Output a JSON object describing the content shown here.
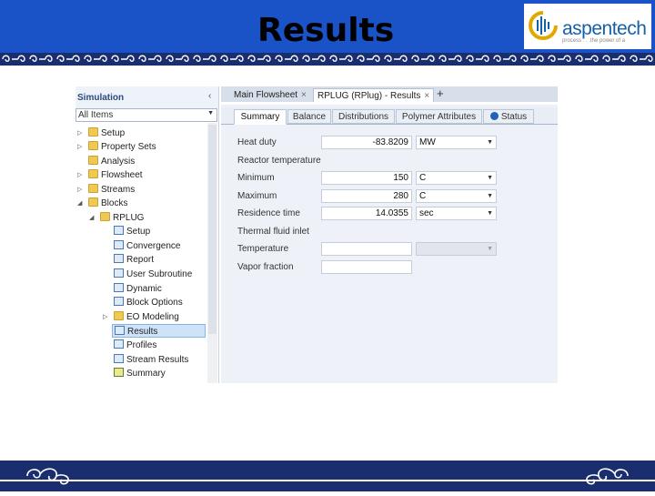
{
  "slide": {
    "title": "Results",
    "logo_text": "aspentech",
    "logo_tagline": "process . . .the power of a",
    "colors": {
      "header_blue": "#1a52c8",
      "pattern_navy": "#1a2d6e",
      "logo_blue": "#1560a8"
    }
  },
  "nav": {
    "title": "Simulation",
    "filter_value": "All Items",
    "items": [
      {
        "label": "Setup",
        "icon": "folder-icon"
      },
      {
        "label": "Property Sets",
        "icon": "folder-icon"
      },
      {
        "label": "Analysis",
        "icon": "folder-icon"
      },
      {
        "label": "Flowsheet",
        "icon": "folder-icon"
      },
      {
        "label": "Streams",
        "icon": "folder-icon"
      },
      {
        "label": "Blocks",
        "icon": "folder-icon"
      },
      {
        "label": "RPLUG",
        "icon": "folder-icon"
      },
      {
        "label": "Setup",
        "icon": "form-check-icon"
      },
      {
        "label": "Convergence",
        "icon": "form-check-icon"
      },
      {
        "label": "Report",
        "icon": "form-check-icon"
      },
      {
        "label": "User Subroutine",
        "icon": "form-check-icon"
      },
      {
        "label": "Dynamic",
        "icon": "form-check-icon"
      },
      {
        "label": "Block Options",
        "icon": "form-check-icon"
      },
      {
        "label": "EO Modeling",
        "icon": "folder-icon"
      },
      {
        "label": "Results",
        "icon": "form-check-icon"
      },
      {
        "label": "Profiles",
        "icon": "form-check-icon"
      },
      {
        "label": "Stream Results",
        "icon": "form-check-icon"
      },
      {
        "label": "Summary",
        "icon": "summary-icon"
      }
    ]
  },
  "doc_tabs": [
    {
      "label": "Main Flowsheet"
    },
    {
      "label": "RPLUG (RPlug) - Results"
    }
  ],
  "sub_tabs": [
    "Summary",
    "Balance",
    "Distributions",
    "Polymer Attributes",
    "Status"
  ],
  "form": {
    "heat_duty": {
      "label": "Heat duty",
      "value": "-83.8209",
      "unit": "MW"
    },
    "reactor_temperature_label": "Reactor temperature",
    "minimum": {
      "label": "Minimum",
      "value": "150",
      "unit": "C"
    },
    "maximum": {
      "label": "Maximum",
      "value": "280",
      "unit": "C"
    },
    "residence_time": {
      "label": "Residence time",
      "value": "14.0355",
      "unit": "sec"
    },
    "thermal_fluid_inlet_label": "Thermal fluid inlet",
    "temperature": {
      "label": "Temperature",
      "value": "",
      "unit": ""
    },
    "vapor_fraction": {
      "label": "Vapor fraction",
      "value": ""
    }
  }
}
